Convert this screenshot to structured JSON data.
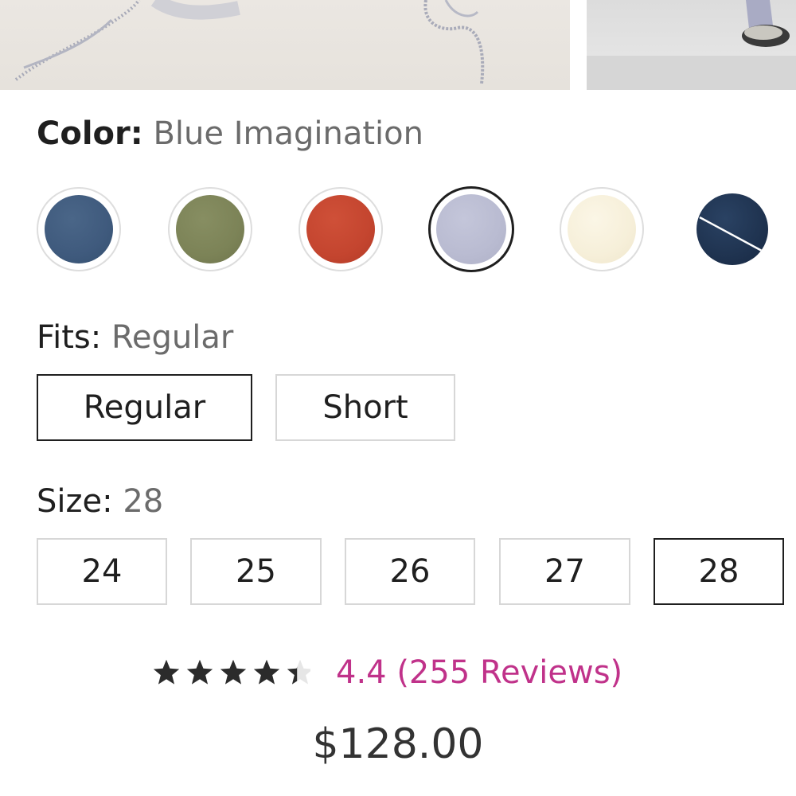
{
  "product_images": [
    {
      "name": "product-image-primary"
    },
    {
      "name": "product-image-secondary"
    }
  ],
  "color": {
    "label": "Color:",
    "value": "Blue Imagination",
    "swatches": [
      {
        "name": "swatch-denim-blue",
        "color": "#3f5a7d",
        "selected": false
      },
      {
        "name": "swatch-olive",
        "color": "#7c8357",
        "selected": false
      },
      {
        "name": "swatch-rust",
        "color": "#c4452f",
        "selected": false
      },
      {
        "name": "swatch-blue-imagination",
        "color": "#b9bbd1",
        "selected": true
      },
      {
        "name": "swatch-cream",
        "color": "#f6efd9",
        "selected": false
      },
      {
        "name": "swatch-dark-denim-unavailable",
        "color": "#1f3350",
        "selected": false,
        "unavailable": true
      }
    ]
  },
  "fits": {
    "label": "Fits:",
    "value": "Regular",
    "options": [
      {
        "label": "Regular",
        "selected": true
      },
      {
        "label": "Short",
        "selected": false
      }
    ]
  },
  "size": {
    "label": "Size:",
    "value": "28",
    "options": [
      {
        "label": "24",
        "selected": false
      },
      {
        "label": "25",
        "selected": false
      },
      {
        "label": "26",
        "selected": false
      },
      {
        "label": "27",
        "selected": false
      },
      {
        "label": "28",
        "selected": true
      }
    ]
  },
  "rating": {
    "value": 4.4,
    "max": 5,
    "text": "4.4 (255 Reviews)",
    "color": "#c0328a"
  },
  "price": "$128.00"
}
